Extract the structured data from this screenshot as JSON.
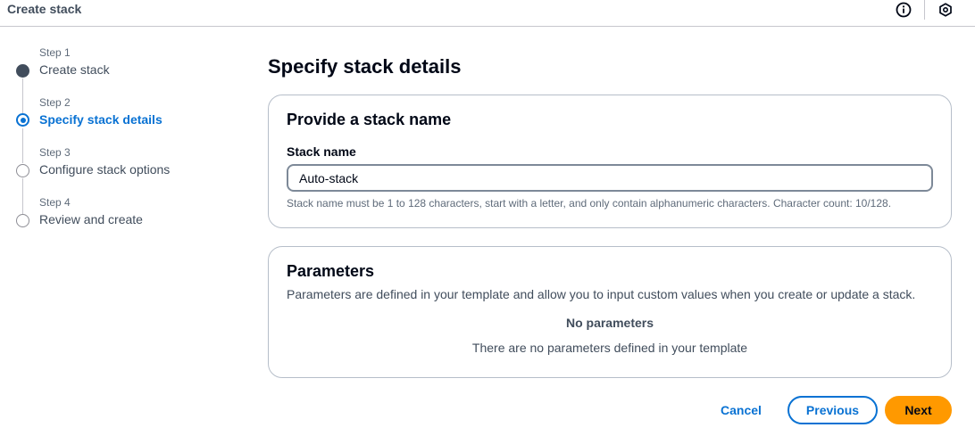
{
  "topbar": {
    "title": "Create stack",
    "icons": [
      "info-icon",
      "hexagon-icon"
    ]
  },
  "steps": [
    {
      "num": "Step 1",
      "label": "Create stack",
      "state": "done"
    },
    {
      "num": "Step 2",
      "label": "Specify stack details",
      "state": "active"
    },
    {
      "num": "Step 3",
      "label": "Configure stack options",
      "state": "pending"
    },
    {
      "num": "Step 4",
      "label": "Review and create",
      "state": "pending"
    }
  ],
  "page": {
    "title": "Specify stack details"
  },
  "stack_name_section": {
    "header": "Provide a stack name",
    "field_label": "Stack name",
    "value": "Auto-stack",
    "constraint": "Stack name must be 1 to 128 characters, start with a letter, and only contain alphanumeric characters. Character count: 10/128."
  },
  "parameters_section": {
    "header": "Parameters",
    "description": "Parameters are defined in your template and allow you to input custom values when you create or update a stack.",
    "empty_title": "No parameters",
    "empty_description": "There are no parameters defined in your template"
  },
  "footer": {
    "cancel_label": "Cancel",
    "previous_label": "Previous",
    "next_label": "Next"
  },
  "colors": {
    "accent": "#0972d3",
    "primary_button": "#ff9900",
    "text": "#000716",
    "muted": "#5f6b7a"
  }
}
